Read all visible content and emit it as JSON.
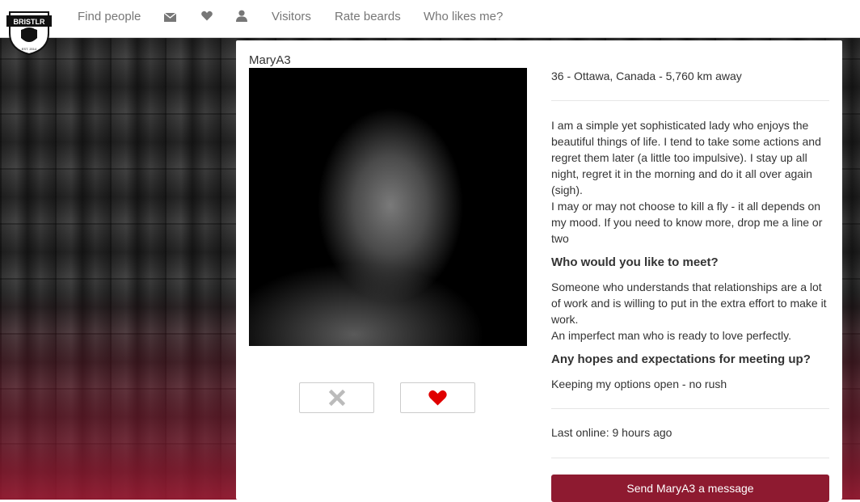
{
  "nav": {
    "logo_text": "BRISTLR",
    "logo_subtext": "EST. 2014",
    "find_people": "Find people",
    "messages_icon": "envelope-icon",
    "likes_icon": "heart-icon",
    "profile_icon": "user-icon",
    "visitors": "Visitors",
    "rate_beards": "Rate beards",
    "who_likes_me": "Who likes me?"
  },
  "profile": {
    "name": "MaryA3",
    "meta": "36 - Ottawa, Canada - 5,760 km away",
    "about": [
      "I am a simple yet sophisticated lady who enjoys the beautiful things of life. I tend to take some actions and regret them later (a little too impulsive). I stay up all night, regret it in the morning and do it all over again (sigh).",
      "I may or may not choose to kill a fly - it all depends on my mood. If you need to know more, drop me a line or two"
    ],
    "meet_heading": "Who would you like to meet?",
    "meet_text": [
      "Someone who understands that relationships are a lot of work and is willing to put in the extra effort to make it work.",
      "An imperfect man who is ready to love perfectly."
    ],
    "hopes_heading": "Any hopes and expectations for meeting up?",
    "hopes_text": "Keeping my options open - no rush",
    "last_online": "Last online: 9 hours ago",
    "send_message": "Send MaryA3 a message"
  },
  "actions": {
    "dislike_icon": "close-icon",
    "like_icon": "heart-icon"
  },
  "colors": {
    "accent": "#8e1a30",
    "like_red": "#e00000",
    "nav_text": "#777777"
  }
}
